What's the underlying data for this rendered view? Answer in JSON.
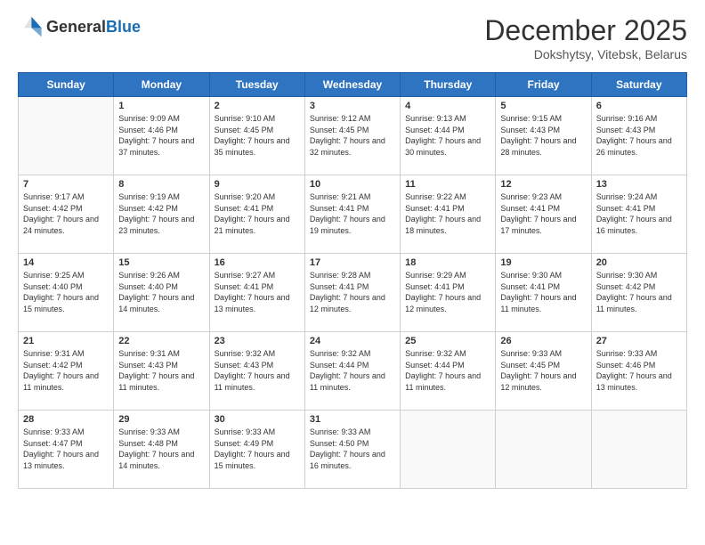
{
  "header": {
    "logo_general": "General",
    "logo_blue": "Blue",
    "month_title": "December 2025",
    "location": "Dokshytsy, Vitebsk, Belarus"
  },
  "weekdays": [
    "Sunday",
    "Monday",
    "Tuesday",
    "Wednesday",
    "Thursday",
    "Friday",
    "Saturday"
  ],
  "days": [
    {
      "num": "",
      "sunrise": "",
      "sunset": "",
      "daylight": ""
    },
    {
      "num": "1",
      "sunrise": "Sunrise: 9:09 AM",
      "sunset": "Sunset: 4:46 PM",
      "daylight": "Daylight: 7 hours and 37 minutes."
    },
    {
      "num": "2",
      "sunrise": "Sunrise: 9:10 AM",
      "sunset": "Sunset: 4:45 PM",
      "daylight": "Daylight: 7 hours and 35 minutes."
    },
    {
      "num": "3",
      "sunrise": "Sunrise: 9:12 AM",
      "sunset": "Sunset: 4:45 PM",
      "daylight": "Daylight: 7 hours and 32 minutes."
    },
    {
      "num": "4",
      "sunrise": "Sunrise: 9:13 AM",
      "sunset": "Sunset: 4:44 PM",
      "daylight": "Daylight: 7 hours and 30 minutes."
    },
    {
      "num": "5",
      "sunrise": "Sunrise: 9:15 AM",
      "sunset": "Sunset: 4:43 PM",
      "daylight": "Daylight: 7 hours and 28 minutes."
    },
    {
      "num": "6",
      "sunrise": "Sunrise: 9:16 AM",
      "sunset": "Sunset: 4:43 PM",
      "daylight": "Daylight: 7 hours and 26 minutes."
    },
    {
      "num": "7",
      "sunrise": "Sunrise: 9:17 AM",
      "sunset": "Sunset: 4:42 PM",
      "daylight": "Daylight: 7 hours and 24 minutes."
    },
    {
      "num": "8",
      "sunrise": "Sunrise: 9:19 AM",
      "sunset": "Sunset: 4:42 PM",
      "daylight": "Daylight: 7 hours and 23 minutes."
    },
    {
      "num": "9",
      "sunrise": "Sunrise: 9:20 AM",
      "sunset": "Sunset: 4:41 PM",
      "daylight": "Daylight: 7 hours and 21 minutes."
    },
    {
      "num": "10",
      "sunrise": "Sunrise: 9:21 AM",
      "sunset": "Sunset: 4:41 PM",
      "daylight": "Daylight: 7 hours and 19 minutes."
    },
    {
      "num": "11",
      "sunrise": "Sunrise: 9:22 AM",
      "sunset": "Sunset: 4:41 PM",
      "daylight": "Daylight: 7 hours and 18 minutes."
    },
    {
      "num": "12",
      "sunrise": "Sunrise: 9:23 AM",
      "sunset": "Sunset: 4:41 PM",
      "daylight": "Daylight: 7 hours and 17 minutes."
    },
    {
      "num": "13",
      "sunrise": "Sunrise: 9:24 AM",
      "sunset": "Sunset: 4:41 PM",
      "daylight": "Daylight: 7 hours and 16 minutes."
    },
    {
      "num": "14",
      "sunrise": "Sunrise: 9:25 AM",
      "sunset": "Sunset: 4:40 PM",
      "daylight": "Daylight: 7 hours and 15 minutes."
    },
    {
      "num": "15",
      "sunrise": "Sunrise: 9:26 AM",
      "sunset": "Sunset: 4:40 PM",
      "daylight": "Daylight: 7 hours and 14 minutes."
    },
    {
      "num": "16",
      "sunrise": "Sunrise: 9:27 AM",
      "sunset": "Sunset: 4:41 PM",
      "daylight": "Daylight: 7 hours and 13 minutes."
    },
    {
      "num": "17",
      "sunrise": "Sunrise: 9:28 AM",
      "sunset": "Sunset: 4:41 PM",
      "daylight": "Daylight: 7 hours and 12 minutes."
    },
    {
      "num": "18",
      "sunrise": "Sunrise: 9:29 AM",
      "sunset": "Sunset: 4:41 PM",
      "daylight": "Daylight: 7 hours and 12 minutes."
    },
    {
      "num": "19",
      "sunrise": "Sunrise: 9:30 AM",
      "sunset": "Sunset: 4:41 PM",
      "daylight": "Daylight: 7 hours and 11 minutes."
    },
    {
      "num": "20",
      "sunrise": "Sunrise: 9:30 AM",
      "sunset": "Sunset: 4:42 PM",
      "daylight": "Daylight: 7 hours and 11 minutes."
    },
    {
      "num": "21",
      "sunrise": "Sunrise: 9:31 AM",
      "sunset": "Sunset: 4:42 PM",
      "daylight": "Daylight: 7 hours and 11 minutes."
    },
    {
      "num": "22",
      "sunrise": "Sunrise: 9:31 AM",
      "sunset": "Sunset: 4:43 PM",
      "daylight": "Daylight: 7 hours and 11 minutes."
    },
    {
      "num": "23",
      "sunrise": "Sunrise: 9:32 AM",
      "sunset": "Sunset: 4:43 PM",
      "daylight": "Daylight: 7 hours and 11 minutes."
    },
    {
      "num": "24",
      "sunrise": "Sunrise: 9:32 AM",
      "sunset": "Sunset: 4:44 PM",
      "daylight": "Daylight: 7 hours and 11 minutes."
    },
    {
      "num": "25",
      "sunrise": "Sunrise: 9:32 AM",
      "sunset": "Sunset: 4:44 PM",
      "daylight": "Daylight: 7 hours and 11 minutes."
    },
    {
      "num": "26",
      "sunrise": "Sunrise: 9:33 AM",
      "sunset": "Sunset: 4:45 PM",
      "daylight": "Daylight: 7 hours and 12 minutes."
    },
    {
      "num": "27",
      "sunrise": "Sunrise: 9:33 AM",
      "sunset": "Sunset: 4:46 PM",
      "daylight": "Daylight: 7 hours and 13 minutes."
    },
    {
      "num": "28",
      "sunrise": "Sunrise: 9:33 AM",
      "sunset": "Sunset: 4:47 PM",
      "daylight": "Daylight: 7 hours and 13 minutes."
    },
    {
      "num": "29",
      "sunrise": "Sunrise: 9:33 AM",
      "sunset": "Sunset: 4:48 PM",
      "daylight": "Daylight: 7 hours and 14 minutes."
    },
    {
      "num": "30",
      "sunrise": "Sunrise: 9:33 AM",
      "sunset": "Sunset: 4:49 PM",
      "daylight": "Daylight: 7 hours and 15 minutes."
    },
    {
      "num": "31",
      "sunrise": "Sunrise: 9:33 AM",
      "sunset": "Sunset: 4:50 PM",
      "daylight": "Daylight: 7 hours and 16 minutes."
    },
    {
      "num": "",
      "sunrise": "",
      "sunset": "",
      "daylight": ""
    },
    {
      "num": "",
      "sunrise": "",
      "sunset": "",
      "daylight": ""
    },
    {
      "num": "",
      "sunrise": "",
      "sunset": "",
      "daylight": ""
    },
    {
      "num": "",
      "sunrise": "",
      "sunset": "",
      "daylight": ""
    }
  ]
}
